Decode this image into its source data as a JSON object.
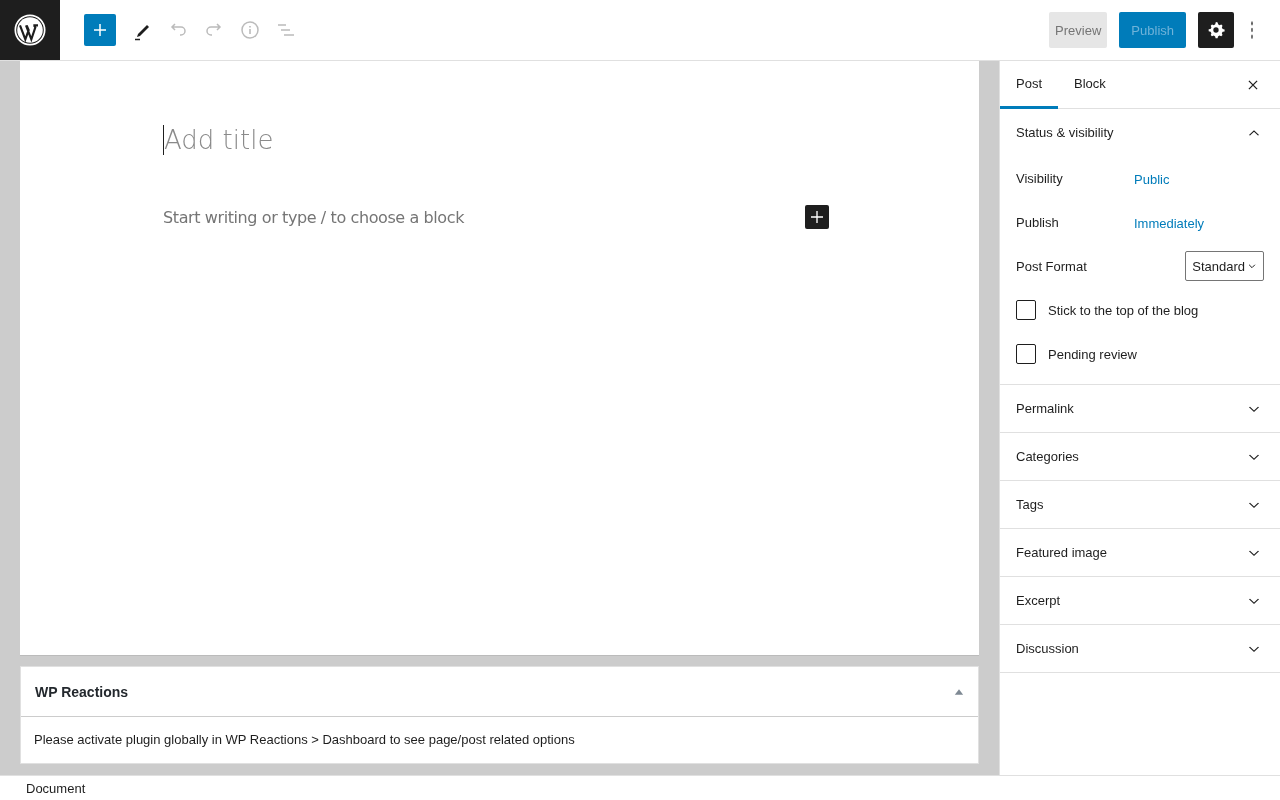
{
  "toolbar": {
    "preview": "Preview",
    "publish": "Publish"
  },
  "editor": {
    "title_placeholder": "Add title",
    "body_placeholder": "Start writing or type / to choose a block"
  },
  "meta_box": {
    "title": "WP Reactions",
    "expanded": true,
    "message": "Please activate plugin globally in WP Reactions > Dashboard to see page/post related options"
  },
  "sidebar": {
    "tabs": [
      {
        "label": "Post",
        "selected": true
      },
      {
        "label": "Block",
        "selected": false
      }
    ],
    "panels": [
      {
        "title": "Status & visibility",
        "expanded": true,
        "rows": [
          {
            "kind": "link",
            "label": "Visibility",
            "value": "Public"
          },
          {
            "kind": "link",
            "label": "Publish",
            "value": "Immediately"
          },
          {
            "kind": "select",
            "label": "Post Format",
            "value": "Standard"
          },
          {
            "kind": "checkbox",
            "label": "Stick to the top of the blog",
            "checked": false
          },
          {
            "kind": "checkbox",
            "label": "Pending review",
            "checked": false
          }
        ]
      },
      {
        "title": "Permalink",
        "expanded": false
      },
      {
        "title": "Categories",
        "expanded": false
      },
      {
        "title": "Tags",
        "expanded": false
      },
      {
        "title": "Featured image",
        "expanded": false
      },
      {
        "title": "Excerpt",
        "expanded": false
      },
      {
        "title": "Discussion",
        "expanded": false
      }
    ]
  },
  "footer": {
    "breadcrumb": "Document"
  }
}
